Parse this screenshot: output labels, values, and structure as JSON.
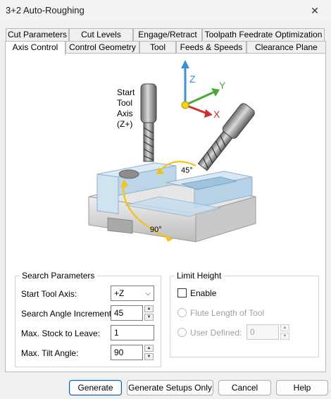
{
  "window": {
    "title": "3+2 Auto-Roughing",
    "close_glyph": "✕"
  },
  "tabs_back": [
    "Cut Parameters",
    "Cut Levels",
    "Engage/Retract",
    "Toolpath Feedrate Optimization"
  ],
  "tabs_front": [
    "Axis Control",
    "Control Geometry",
    "Tool",
    "Feeds & Speeds",
    "Clearance Plane"
  ],
  "active_tab": "Axis Control",
  "illustration": {
    "start_axis_label": [
      "Start",
      "Tool",
      "Axis",
      "(Z+)"
    ],
    "angle_45": "45°",
    "angle_90": "90°",
    "axis_z": "Z",
    "axis_y": "Y",
    "axis_x": "X",
    "colors": {
      "z": "#3d8fd6",
      "y": "#4aa83a",
      "x": "#d12f2f",
      "origin": "#f2d51a",
      "arc": "#f1c31c"
    }
  },
  "search_params": {
    "title": "Search Parameters",
    "start_tool_axis_label": "Start Tool Axis:",
    "start_tool_axis_value": "+Z",
    "search_angle_increment_label": "Search Angle Increment:",
    "search_angle_increment_value": "45",
    "max_stock_label": "Max. Stock to Leave:",
    "max_stock_value": "1",
    "max_tilt_label": "Max. Tilt Angle:",
    "max_tilt_value": "90"
  },
  "limit_height": {
    "title": "Limit Height",
    "enable_label": "Enable",
    "flute_length_label": "Flute Length of Tool",
    "user_defined_label": "User Defined:",
    "user_defined_value": "0"
  },
  "buttons": {
    "generate": "Generate",
    "generate_setups_only": "Generate Setups Only",
    "cancel": "Cancel",
    "help": "Help"
  }
}
